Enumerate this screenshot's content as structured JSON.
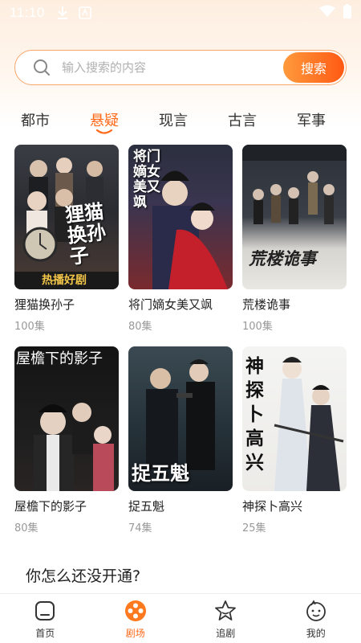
{
  "status": {
    "time": "11:10",
    "icons": [
      "download-icon",
      "app-icon",
      "wifi-icon",
      "battery-icon"
    ]
  },
  "search": {
    "placeholder": "输入搜索的内容",
    "button_label": "搜索"
  },
  "tabs": [
    {
      "label": "都市",
      "active": false
    },
    {
      "label": "悬疑",
      "active": true
    },
    {
      "label": "现言",
      "active": false
    },
    {
      "label": "古言",
      "active": false
    },
    {
      "label": "军事",
      "active": false
    }
  ],
  "dramas": [
    {
      "title": "狸猫换孙子",
      "episodes": "100集",
      "poster_text": "狸猫换孙子",
      "poster_tag": "热播好剧"
    },
    {
      "title": "将门嫡女美又飒",
      "episodes": "80集",
      "poster_text": "将门嫡女美又飒"
    },
    {
      "title": "荒楼诡事",
      "episodes": "100集",
      "poster_text": "荒楼诡事"
    },
    {
      "title": "屋檐下的影子",
      "episodes": "80集",
      "poster_text": "屋檐下的影子"
    },
    {
      "title": "捉五魁",
      "episodes": "74集",
      "poster_text": "捉五魁"
    },
    {
      "title": "神探卜高兴",
      "episodes": "25集",
      "poster_text": "神探卜高兴"
    }
  ],
  "promo_text": "你怎么还没开通?",
  "nav": [
    {
      "label": "首页",
      "icon": "home-icon",
      "active": false
    },
    {
      "label": "剧场",
      "icon": "theater-icon",
      "active": true
    },
    {
      "label": "追剧",
      "icon": "star-icon",
      "active": false
    },
    {
      "label": "我的",
      "icon": "profile-icon",
      "active": false
    }
  ],
  "colors": {
    "accent": "#ff6a1a",
    "accent_gradient_start": "#ff9a3c",
    "search_border": "#f7a569"
  }
}
